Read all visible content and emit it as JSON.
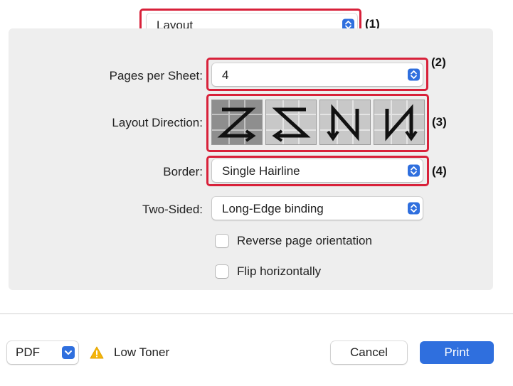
{
  "section_popup": {
    "value": "Layout"
  },
  "pages_per_sheet": {
    "label": "Pages per Sheet:",
    "value": "4"
  },
  "layout_direction": {
    "label": "Layout Direction:",
    "options": [
      {
        "icon": "layout-z-icon",
        "selected": true
      },
      {
        "icon": "layout-reverse-z-icon",
        "selected": false
      },
      {
        "icon": "layout-reverse-n-icon",
        "selected": false
      },
      {
        "icon": "layout-n-icon",
        "selected": false
      }
    ]
  },
  "border": {
    "label": "Border:",
    "value": "Single Hairline"
  },
  "two_sided": {
    "label": "Two-Sided:",
    "value": "Long-Edge binding"
  },
  "reverse_orientation": {
    "label": "Reverse page orientation",
    "checked": false
  },
  "flip_horizontally": {
    "label": "Flip horizontally",
    "checked": false
  },
  "markers": [
    "(1)",
    "(2)",
    "(3)",
    "(4)"
  ],
  "footer": {
    "pdf_label": "PDF",
    "warning_icon": "warning-triangle-icon",
    "warning_text": "Low Toner",
    "cancel_label": "Cancel",
    "print_label": "Print"
  },
  "colors": {
    "accent": "#2f6fde",
    "highlight": "#d8213a",
    "warning": "#f5b50a"
  }
}
